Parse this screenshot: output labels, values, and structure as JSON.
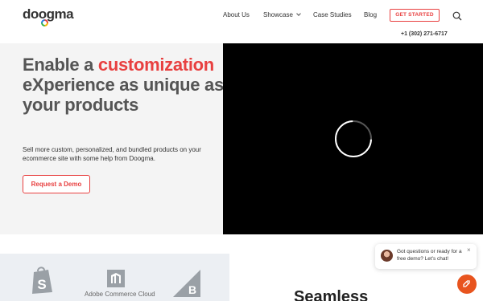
{
  "brand": {
    "logo_text": "doogma"
  },
  "nav": {
    "items": [
      "About Us",
      "Showcase",
      "Case Studies",
      "Blog"
    ],
    "cta": "GET STARTED",
    "phone": "+1 (302) 271-6717"
  },
  "hero": {
    "headline_pre": "Enable a ",
    "headline_accent": "customization",
    "headline_rest": " eXperience as unique as your products",
    "subtext": "Sell more custom, personalized, and bundled products on your ecommerce site with some help from Doogma.",
    "button": "Request a Demo"
  },
  "integrations": {
    "adobe_label": "Adobe Commerce Cloud"
  },
  "section_title": "Seamless",
  "chat": {
    "message": "Got questions or ready for a free demo? Let's chat!",
    "close": "×"
  },
  "colors": {
    "accent": "#e84040",
    "chat": "#e8541e",
    "video_bg": "#000000"
  },
  "icons": [
    "search-icon",
    "chevron-down-icon",
    "shopify-icon",
    "adobe-commerce-icon",
    "bigcommerce-icon",
    "chat-icon",
    "close-icon"
  ]
}
